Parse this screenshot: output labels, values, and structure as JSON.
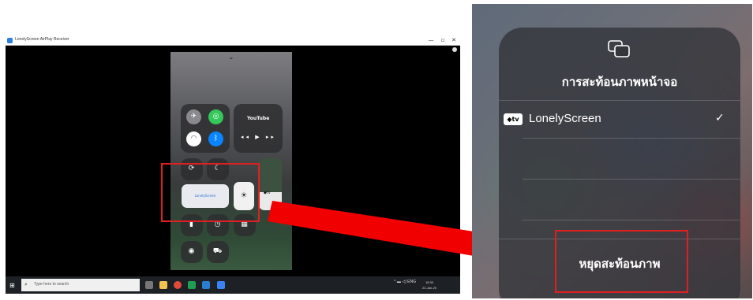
{
  "desktop": {
    "window_title": "LonelyScreen AirPlay Receiver",
    "buttons": {
      "minimize": "—",
      "maximize": "▫",
      "close": "✕"
    }
  },
  "control_center": {
    "handle": "⌄",
    "youtube_label": "YouTube",
    "media_controls": "◂◂ ▶ ▸▸",
    "lonelyscreen_tile": "LonelyScreen",
    "brightness_icon": "☀",
    "appletv_mini": "◆tv"
  },
  "taskbar": {
    "search_placeholder": "Type here to search",
    "tray_text": "^ ▬ ◁) ENG",
    "clock_time": "18:30",
    "clock_date": "22-Jan-20"
  },
  "mirroring": {
    "title": "การสะท้อนภาพหน้าจอ",
    "device_badge": "◆tv",
    "device_name": "LonelyScreen",
    "checkmark": "✓",
    "stop_label": "หยุดสะท้อนภาพ"
  },
  "colors": {
    "highlight": "#e02020",
    "arrow": "#f00000",
    "panel_bg": "#34363c"
  }
}
